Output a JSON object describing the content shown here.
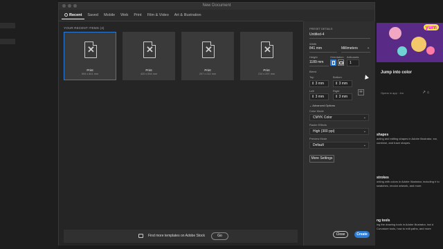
{
  "window": {
    "title": "New Document"
  },
  "tabs": [
    {
      "label": "Recent"
    },
    {
      "label": "Saved"
    },
    {
      "label": "Mobile"
    },
    {
      "label": "Web"
    },
    {
      "label": "Print"
    },
    {
      "label": "Film & Video"
    },
    {
      "label": "Art & Illustration"
    }
  ],
  "recent": {
    "title": "YOUR RECENT ITEMS",
    "count": "(4)",
    "items": [
      {
        "name": "Print",
        "dims": "594 x 841 mm",
        "icon": "document-x-icon"
      },
      {
        "name": "Print",
        "dims": "420 x 594 mm",
        "icon": "document-x-icon"
      },
      {
        "name": "Print",
        "dims": "297 x 210 mm",
        "icon": "document-x-icon"
      },
      {
        "name": "Print",
        "dims": "210 x 297 mm",
        "icon": "document-x-icon"
      }
    ]
  },
  "stock": {
    "label": "Find more templates on Adobe Stock",
    "go": "Go"
  },
  "preset": {
    "heading": "PRESET DETAILS",
    "name": "Untitled-4",
    "width_label": "Width",
    "width": "841 mm",
    "units": "Millimeters",
    "height_label": "Height",
    "height": "1189 mm",
    "orientation_label": "Orientation",
    "artboards_label": "Artboards",
    "artboards": "1",
    "bleed_label": "Bleed",
    "top_label": "Top",
    "top": "3 mm",
    "bottom_label": "Bottom",
    "bottom": "3 mm",
    "left_label": "Left",
    "left": "3 mm",
    "right_label": "Right",
    "right": "3 mm",
    "advanced_label": "Advanced Options",
    "color_mode_label": "Color Mode",
    "color_mode": "CMYK Color",
    "raster_label": "Raster Effects",
    "raster": "High (300 ppi)",
    "preview_label": "Preview Mode",
    "preview": "Default",
    "more_settings": "More Settings"
  },
  "buttons": {
    "close": "Close",
    "create": "Create"
  },
  "background": {
    "hero_badge": "yum",
    "card_title": "Jump into color",
    "card_meta": "Opens in app · 4m",
    "sections": [
      {
        "title": "shapes",
        "text": "acting and editing shapes in Adobe Illustrator, ew, combine, and trace shapes."
      },
      {
        "title": "strokes",
        "text": "orking with colors in Adobe Illustrator, including h to swatches, recolor artwork, and more."
      },
      {
        "title": "ng tools",
        "text": "ing the drawing tools in Adobe Illustrator, incl d Curvature tools, how to edit paths, and more"
      }
    ]
  },
  "colors": {
    "accent": "#2e7bd6",
    "dialog_bg": "#2b2b2b",
    "panel_bg": "#2f2f2f"
  }
}
